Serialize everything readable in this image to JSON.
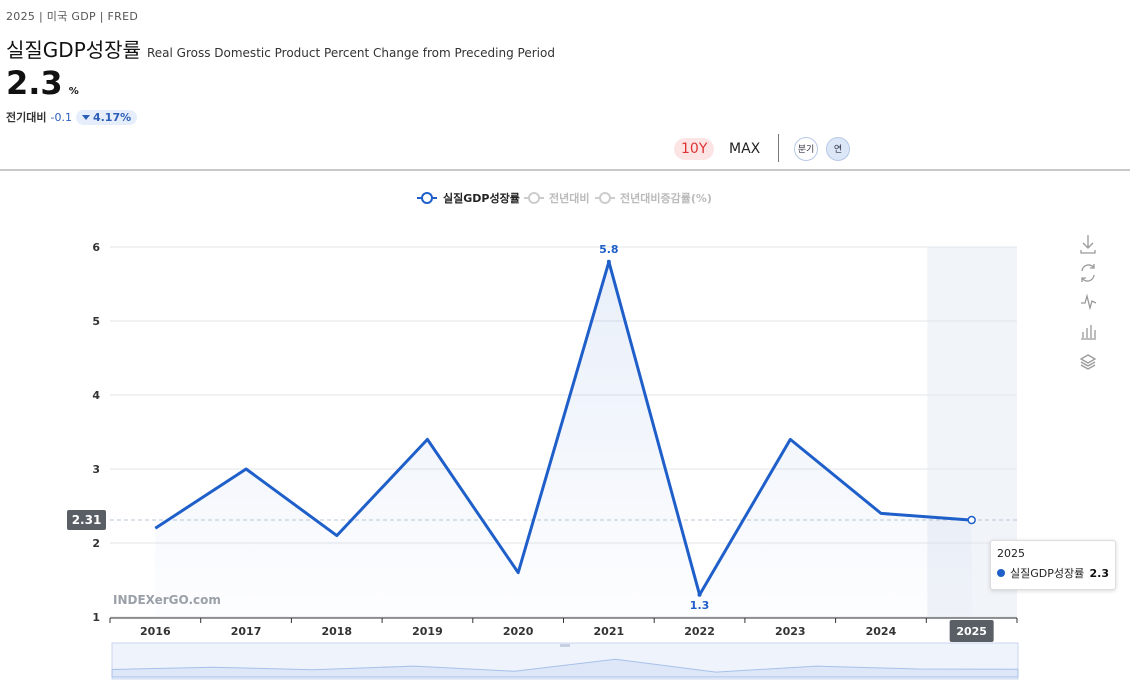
{
  "header": {
    "meta": "2025 | 미국 GDP | FRED",
    "title_ko": "실질GDP성장률",
    "title_en": "Real Gross Domestic Product Percent Change from Preceding Period",
    "value": "2.3",
    "unit": "%",
    "change_label": "전기대비",
    "change_value": "-0.1",
    "change_pct": "4.17%"
  },
  "controls": {
    "range_10y": "10Y",
    "range_max": "MAX",
    "freq_quarter": "분기",
    "freq_year": "연"
  },
  "legend": [
    {
      "name": "실질GDP성장률",
      "active": true
    },
    {
      "name": "전년대비",
      "active": false
    },
    {
      "name": "전년대비증감률(%)",
      "active": false
    }
  ],
  "watermark": "INDEXerGO.com",
  "tooltip": {
    "year": "2025",
    "series": "실질GDP성장률",
    "value": "2.3"
  },
  "current_label": "2.31",
  "colors": {
    "line": "#1f5fc9",
    "accent_red": "#d33333",
    "highlight_band": "#f1f4f9"
  },
  "toolbar_icons": [
    "download-icon",
    "refresh-icon",
    "line-chart-icon",
    "bar-chart-icon",
    "layers-icon"
  ],
  "chart_data": {
    "type": "line",
    "categories": [
      "2016",
      "2017",
      "2018",
      "2019",
      "2020",
      "2021",
      "2022",
      "2023",
      "2024",
      "2025"
    ],
    "series": [
      {
        "name": "실질GDP성장률",
        "values": [
          2.2,
          3.0,
          2.1,
          3.4,
          1.6,
          5.8,
          1.3,
          3.4,
          2.4,
          2.31
        ]
      }
    ],
    "labeled_points": [
      {
        "category": "2021",
        "label": "5.8"
      },
      {
        "category": "2022",
        "label": "1.3"
      }
    ],
    "highlight_category": "2025",
    "yticks": [
      "1",
      "2",
      "3",
      "4",
      "5",
      "6"
    ],
    "ylim": [
      1,
      6
    ],
    "grid": true
  }
}
